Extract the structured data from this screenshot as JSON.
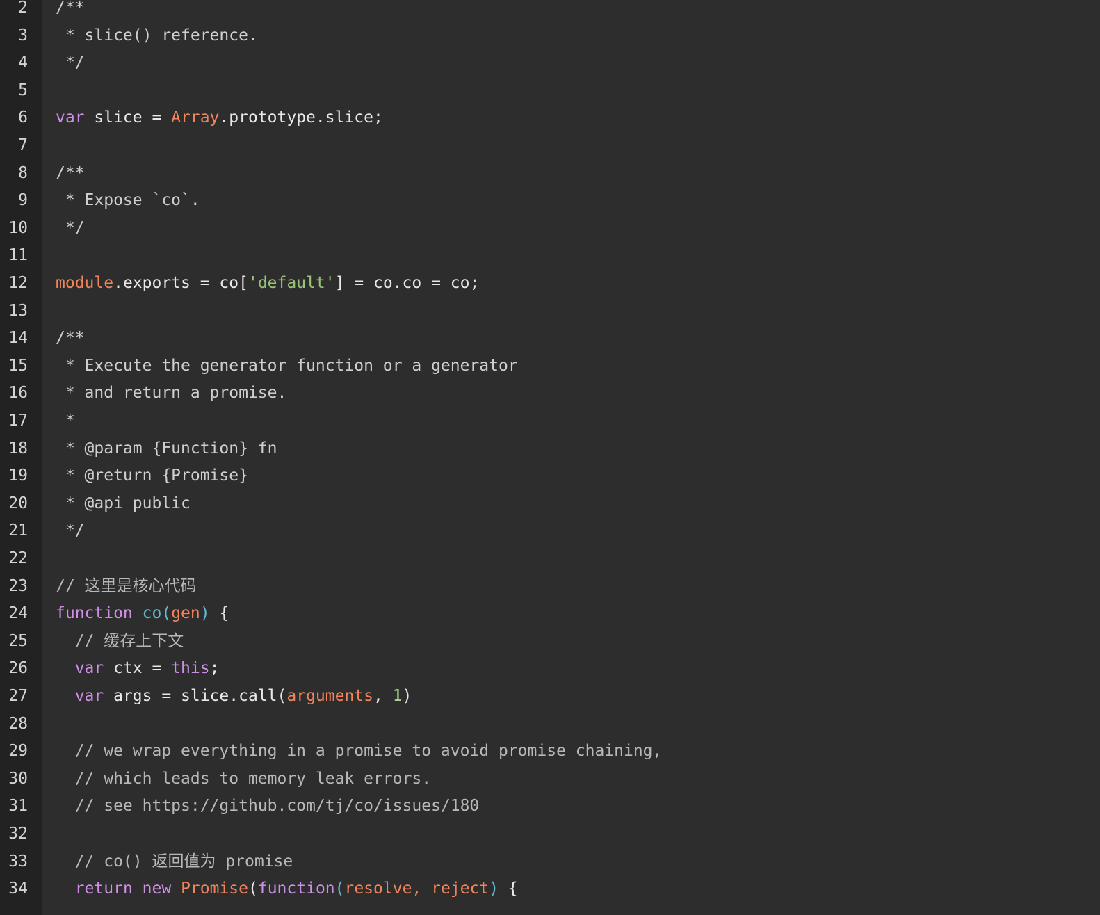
{
  "editor": {
    "theme_colors": {
      "background": "#2d2d2d",
      "gutter": "#222222",
      "keyword": "#cf8fe6",
      "function_name": "#66b8d1",
      "builtin": "#f2845c",
      "string": "#98c379",
      "number": "#a8d48c",
      "comment": "#b8b8b8"
    },
    "lines": [
      {
        "n": "2",
        "tokens": [
          {
            "t": "/**",
            "c": "com"
          }
        ]
      },
      {
        "n": "3",
        "tokens": [
          {
            "t": " * slice() reference.",
            "c": "com"
          }
        ]
      },
      {
        "n": "4",
        "tokens": [
          {
            "t": " */",
            "c": "com"
          }
        ]
      },
      {
        "n": "5",
        "tokens": []
      },
      {
        "n": "6",
        "tokens": [
          {
            "t": "var",
            "c": "kw"
          },
          {
            "t": " slice = ",
            "c": "pl"
          },
          {
            "t": "Array",
            "c": "bi"
          },
          {
            "t": ".prototype.slice;",
            "c": "pl"
          }
        ]
      },
      {
        "n": "7",
        "tokens": []
      },
      {
        "n": "8",
        "tokens": [
          {
            "t": "/**",
            "c": "com"
          }
        ]
      },
      {
        "n": "9",
        "tokens": [
          {
            "t": " * Expose `co`.",
            "c": "com"
          }
        ]
      },
      {
        "n": "10",
        "tokens": [
          {
            "t": " */",
            "c": "com"
          }
        ]
      },
      {
        "n": "11",
        "tokens": []
      },
      {
        "n": "12",
        "tokens": [
          {
            "t": "module",
            "c": "bi"
          },
          {
            "t": ".exports = co[",
            "c": "pl"
          },
          {
            "t": "'default'",
            "c": "str"
          },
          {
            "t": "] = co.co = co;",
            "c": "pl"
          }
        ]
      },
      {
        "n": "13",
        "tokens": []
      },
      {
        "n": "14",
        "tokens": [
          {
            "t": "/**",
            "c": "com"
          }
        ]
      },
      {
        "n": "15",
        "tokens": [
          {
            "t": " * Execute the generator function or a generator",
            "c": "com"
          }
        ]
      },
      {
        "n": "16",
        "tokens": [
          {
            "t": " * and return a promise.",
            "c": "com"
          }
        ]
      },
      {
        "n": "17",
        "tokens": [
          {
            "t": " *",
            "c": "com"
          }
        ]
      },
      {
        "n": "18",
        "tokens": [
          {
            "t": " * @param {Function} fn",
            "c": "com"
          }
        ]
      },
      {
        "n": "19",
        "tokens": [
          {
            "t": " * @return {Promise}",
            "c": "com"
          }
        ]
      },
      {
        "n": "20",
        "tokens": [
          {
            "t": " * @api public",
            "c": "com"
          }
        ]
      },
      {
        "n": "21",
        "tokens": [
          {
            "t": " */",
            "c": "com"
          }
        ]
      },
      {
        "n": "22",
        "tokens": []
      },
      {
        "n": "23",
        "tokens": [
          {
            "t": "// 这里是核心代码",
            "c": "cm2"
          }
        ]
      },
      {
        "n": "24",
        "tokens": [
          {
            "t": "function",
            "c": "kw"
          },
          {
            "t": " ",
            "c": "pl"
          },
          {
            "t": "co",
            "c": "fn"
          },
          {
            "t": "(",
            "c": "fn"
          },
          {
            "t": "gen",
            "c": "bi"
          },
          {
            "t": ")",
            "c": "fn"
          },
          {
            "t": " {",
            "c": "pl"
          }
        ]
      },
      {
        "n": "25",
        "tokens": [
          {
            "t": "  // 缓存上下文",
            "c": "cm2"
          }
        ]
      },
      {
        "n": "26",
        "tokens": [
          {
            "t": "  ",
            "c": "pl"
          },
          {
            "t": "var",
            "c": "kw"
          },
          {
            "t": " ctx = ",
            "c": "pl"
          },
          {
            "t": "this",
            "c": "kw"
          },
          {
            "t": ";",
            "c": "pl"
          }
        ]
      },
      {
        "n": "27",
        "tokens": [
          {
            "t": "  ",
            "c": "pl"
          },
          {
            "t": "var",
            "c": "kw"
          },
          {
            "t": " args = slice.call(",
            "c": "pl"
          },
          {
            "t": "arguments",
            "c": "bi"
          },
          {
            "t": ", ",
            "c": "pl"
          },
          {
            "t": "1",
            "c": "num"
          },
          {
            "t": ")",
            "c": "pl"
          }
        ]
      },
      {
        "n": "28",
        "tokens": []
      },
      {
        "n": "29",
        "tokens": [
          {
            "t": "  // we wrap everything in a promise to avoid promise chaining,",
            "c": "cm2"
          }
        ]
      },
      {
        "n": "30",
        "tokens": [
          {
            "t": "  // which leads to memory leak errors.",
            "c": "cm2"
          }
        ]
      },
      {
        "n": "31",
        "tokens": [
          {
            "t": "  // see https://github.com/tj/co/issues/180",
            "c": "cm2"
          }
        ]
      },
      {
        "n": "32",
        "tokens": []
      },
      {
        "n": "33",
        "tokens": [
          {
            "t": "  // co() 返回值为 promise",
            "c": "cm2"
          }
        ]
      },
      {
        "n": "34",
        "tokens": [
          {
            "t": "  ",
            "c": "pl"
          },
          {
            "t": "return",
            "c": "kw"
          },
          {
            "t": " ",
            "c": "pl"
          },
          {
            "t": "new",
            "c": "kw"
          },
          {
            "t": " ",
            "c": "pl"
          },
          {
            "t": "Promise",
            "c": "bi"
          },
          {
            "t": "(",
            "c": "pl"
          },
          {
            "t": "function",
            "c": "kw"
          },
          {
            "t": "(",
            "c": "fn"
          },
          {
            "t": "resolve, reject",
            "c": "bi"
          },
          {
            "t": ")",
            "c": "fn"
          },
          {
            "t": " {",
            "c": "pl"
          }
        ]
      }
    ]
  }
}
